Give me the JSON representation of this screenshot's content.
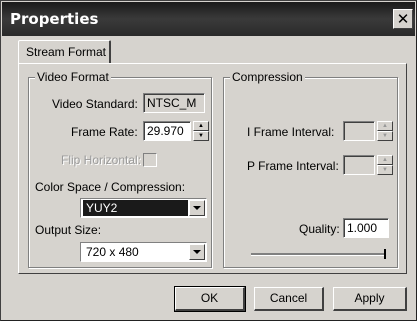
{
  "window": {
    "title": "Properties",
    "close_glyph": "✕"
  },
  "tabs": [
    {
      "label": "Stream Format"
    }
  ],
  "video_format": {
    "title": "Video Format",
    "standard_label": "Video Standard:",
    "standard_value": "NTSC_M",
    "frame_rate_label": "Frame Rate:",
    "frame_rate_value": "29.970",
    "flip_label": "Flip Horizontal:",
    "color_space_label": "Color Space / Compression:",
    "color_space_value": "YUY2",
    "output_size_label": "Output Size:",
    "output_size_value": "720 x 480"
  },
  "compression": {
    "title": "Compression",
    "i_frame_label": "I Frame Interval:",
    "i_frame_value": "",
    "p_frame_label": "P Frame Interval:",
    "p_frame_value": "",
    "quality_label": "Quality:",
    "quality_value": "1.000",
    "quality_slider_fraction": 1.0
  },
  "buttons": {
    "ok": "OK",
    "cancel": "Cancel",
    "apply": "Apply"
  },
  "icons": {
    "close": "close-icon",
    "spin_up": "spin-up-icon",
    "spin_down": "spin-down-icon",
    "dropdown": "chevron-down-icon"
  }
}
